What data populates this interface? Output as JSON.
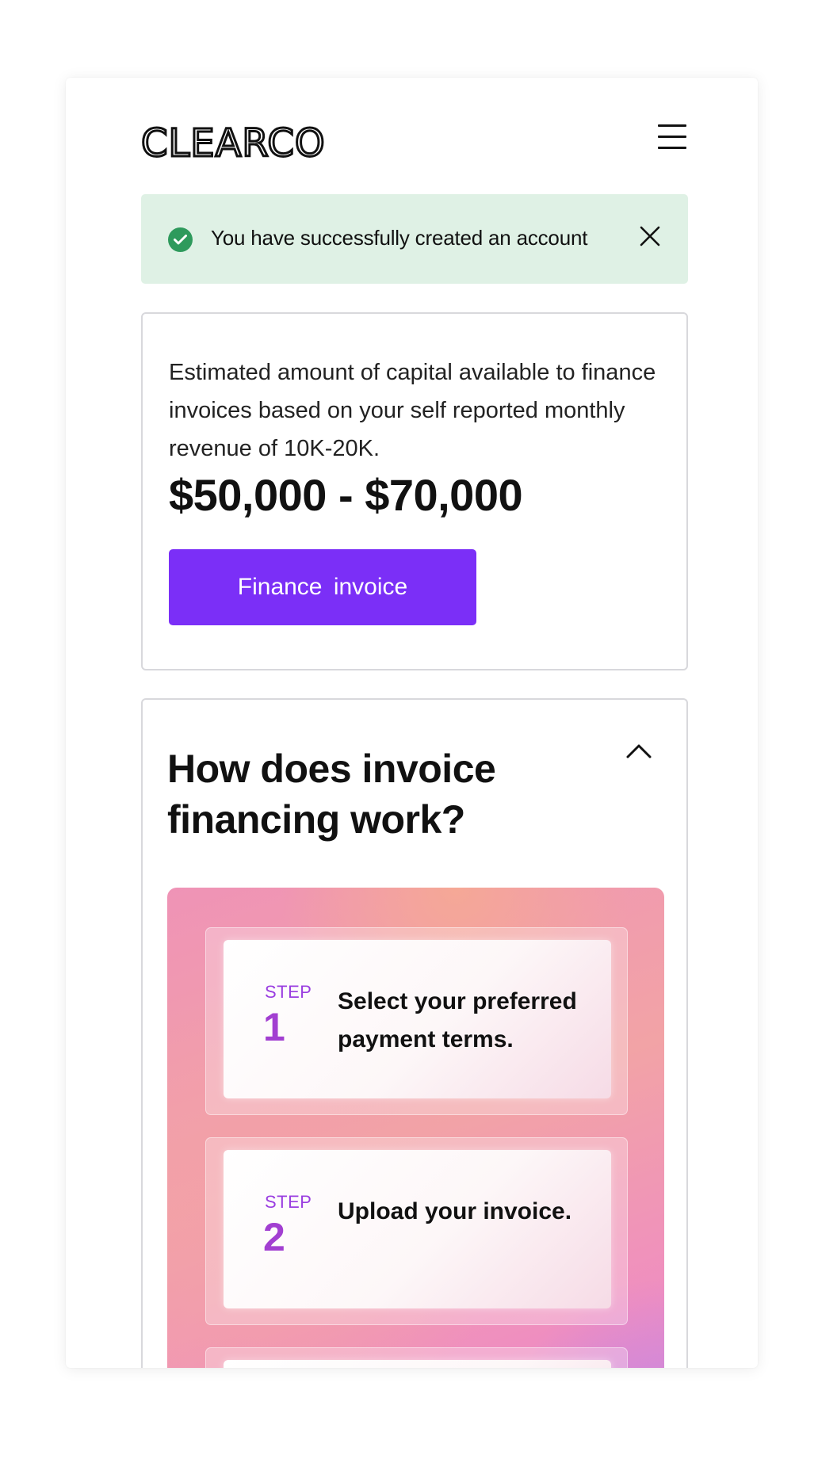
{
  "header": {
    "logo_text": "CLEARCO",
    "menu_icon": "hamburger-menu-icon"
  },
  "alert": {
    "icon": "check-circle-icon",
    "message": "You have successfully created an account",
    "close_icon": "close-icon",
    "colors": {
      "background": "#dff1e5",
      "icon": "#2e9a5c"
    }
  },
  "estimate_card": {
    "description": "Estimated amount of capital available to finance invoices based on your self reported monthly revenue of 10K-20K.",
    "amount": "$50,000 - $70,000",
    "cta_label": "Finance  invoice",
    "colors": {
      "cta": "#7b2ff7"
    }
  },
  "how_it_works": {
    "title": "How does invoice financing work?",
    "toggle_icon": "chevron-up-icon",
    "steps": [
      {
        "label": "STEP",
        "number": "1",
        "text": "Select your preferred payment terms."
      },
      {
        "label": "STEP",
        "number": "2",
        "text": "Upload your invoice."
      }
    ]
  }
}
